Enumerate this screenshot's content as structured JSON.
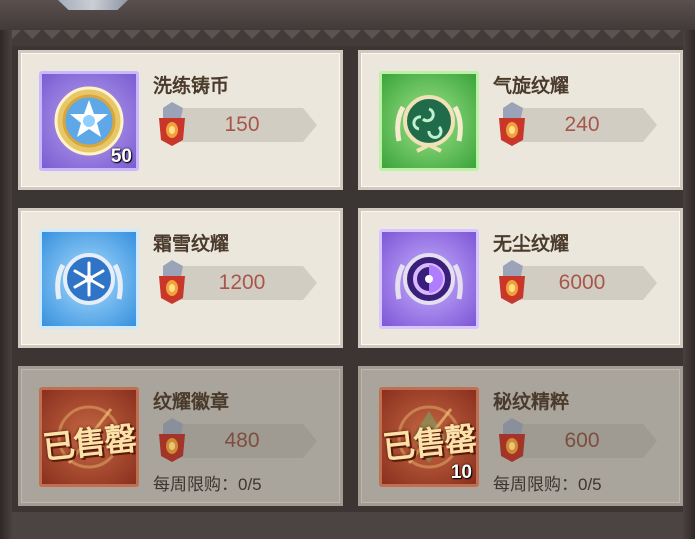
{
  "colors": {
    "price_text": "#a6574a",
    "card_bg": "#ece7dc",
    "sold_card_bg": "#aaa59c"
  },
  "items": [
    {
      "name": "洗练铸币",
      "price": "150",
      "qty": "50",
      "icon": "star-coin-icon",
      "frame": "purple"
    },
    {
      "name": "气旋纹耀",
      "price": "240",
      "qty": "",
      "icon": "wind-swirl-emblem-icon",
      "frame": "green"
    },
    {
      "name": "霜雪纹耀",
      "price": "1200",
      "qty": "",
      "icon": "snowflake-emblem-icon",
      "frame": "blue"
    },
    {
      "name": "无尘纹耀",
      "price": "6000",
      "qty": "",
      "icon": "void-emblem-icon",
      "frame": "violet"
    },
    {
      "name": "纹耀徽章",
      "price": "480",
      "qty": "",
      "icon": "badge-icon",
      "frame": "red",
      "sold_label": "已售罄",
      "limit": "每周限购：0/5"
    },
    {
      "name": "秘纹精粹",
      "price": "600",
      "qty": "10",
      "icon": "essence-icon",
      "frame": "red",
      "sold_label": "已售罄",
      "limit": "每周限购：0/5"
    }
  ],
  "currency_icon": "crystal-currency-icon"
}
